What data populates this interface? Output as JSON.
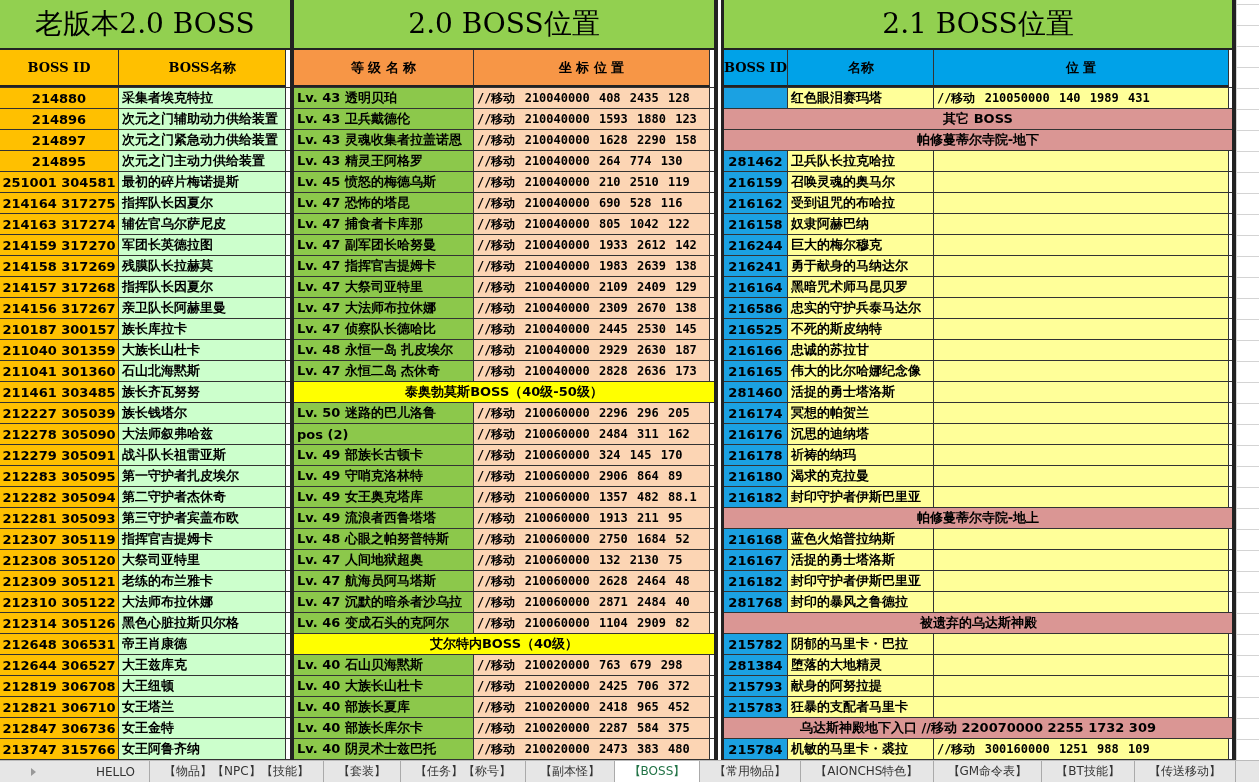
{
  "titles": [
    "老版本2.0 BOSS",
    "2.0 BOSS位置",
    "2.1 BOSS位置"
  ],
  "headers": {
    "old": [
      "BOSS ID",
      "BOSS名称"
    ],
    "v20": [
      "等 级 名 称",
      "坐 标 位 置"
    ],
    "v21": [
      "BOSS ID",
      "名称",
      "位  置"
    ]
  },
  "old_rows": [
    {
      "id": "214880",
      "name": "采集者埃克特拉"
    },
    {
      "id": "214896",
      "name": "次元之门辅助动力供给装置"
    },
    {
      "id": "214897",
      "name": "次元之门紧急动力供给装置"
    },
    {
      "id": "214895",
      "name": "次元之门主动力供给装置"
    },
    {
      "id": "251001 304581",
      "name": "最初的碎片梅诺提斯"
    },
    {
      "id": "214164 317275",
      "name": "指挥队长因夏尔"
    },
    {
      "id": "214163 317274",
      "name": "辅佐官乌尔萨尼皮"
    },
    {
      "id": "214159 317270",
      "name": "军团长英德拉图"
    },
    {
      "id": "214158 317269",
      "name": "残膜队长拉赫莫"
    },
    {
      "id": "214157 317268",
      "name": "指挥队长因夏尔"
    },
    {
      "id": "214156 317267",
      "name": "亲卫队长阿赫里曼"
    },
    {
      "id": "210187 300157",
      "name": "族长库拉卡"
    },
    {
      "id": "211040 301359",
      "name": "大族长山杜卡"
    },
    {
      "id": "211041 301360",
      "name": "石山北海黙斯"
    },
    {
      "id": "211461 303485",
      "name": "族长齐瓦努努"
    },
    {
      "id": "212227 305039",
      "name": "族长钱塔尔"
    },
    {
      "id": "212278 305090",
      "name": "大法师叙弗哈兹"
    },
    {
      "id": "212279 305091",
      "name": "战斗队长祖雷亚斯"
    },
    {
      "id": "212283 305095",
      "name": "第一守护者扎皮埃尔"
    },
    {
      "id": "212282 305094",
      "name": "第二守护者杰休奇"
    },
    {
      "id": "212281 305093",
      "name": "第三守护者宾盖布欧"
    },
    {
      "id": "212307 305119",
      "name": "指挥官吉提姆卡"
    },
    {
      "id": "212308 305120",
      "name": "大祭司亚特里"
    },
    {
      "id": "212309 305121",
      "name": "老练的布兰雅卡"
    },
    {
      "id": "212310 305122",
      "name": "大法师布拉休娜"
    },
    {
      "id": "212314 305126",
      "name": "黑色心脏拉斯贝尔格"
    },
    {
      "id": "212648 306531",
      "name": "帝王肖康德"
    },
    {
      "id": "212644 306527",
      "name": "大王兹库克"
    },
    {
      "id": "212819 306708",
      "name": "大王纽顿"
    },
    {
      "id": "212821 306710",
      "name": "女王塔兰"
    },
    {
      "id": "212847 306736",
      "name": "女王金特"
    },
    {
      "id": "213747 315766",
      "name": "女王阿鲁齐纳"
    }
  ],
  "v20_rows": [
    {
      "kind": "boss",
      "level": "Lv. 43 透明贝珀",
      "coords": "//移动 210040000 408 2435 128"
    },
    {
      "kind": "boss",
      "level": "Lv. 43 卫兵戴德伦",
      "coords": "//移动 210040000 1593 1880 123"
    },
    {
      "kind": "boss",
      "level": "Lv. 43 灵魂收集者拉盖诺恩",
      "coords": "//移动 210040000 1628 2290 158"
    },
    {
      "kind": "boss",
      "level": "Lv. 43 精灵王阿格罗",
      "coords": "//移动 210040000 264 774 130"
    },
    {
      "kind": "boss",
      "level": "Lv. 45 愤怒的梅德乌斯",
      "coords": "//移动 210040000 210 2510 119"
    },
    {
      "kind": "boss",
      "level": "Lv. 47 恐怖的塔昆",
      "coords": "//移动 210040000 690 528 116"
    },
    {
      "kind": "boss",
      "level": "Lv. 47 捕食者卡库那",
      "coords": "//移动 210040000 805 1042 122"
    },
    {
      "kind": "boss",
      "level": "Lv. 47 副军团长哈努曼",
      "coords": "//移动 210040000 1933 2612 142"
    },
    {
      "kind": "boss",
      "level": "Lv. 47 指挥官吉提姆卡",
      "coords": "//移动 210040000 1983 2639 138"
    },
    {
      "kind": "boss",
      "level": "Lv. 47 大祭司亚特里",
      "coords": "//移动 210040000 2109 2409 129"
    },
    {
      "kind": "boss",
      "level": "Lv. 47 大法师布拉休娜",
      "coords": "//移动 210040000 2309 2670 138"
    },
    {
      "kind": "boss",
      "level": "Lv. 47 侦察队长德哈比",
      "coords": "//移动 210040000 2445 2530 145"
    },
    {
      "kind": "boss",
      "level": "Lv. 48 永恒一岛 扎皮埃尔",
      "coords": "//移动 210040000 2929 2630 187"
    },
    {
      "kind": "boss",
      "level": "Lv. 47 永恒二岛 杰休奇",
      "coords": "//移动 210040000 2828 2636 173"
    },
    {
      "kind": "section",
      "title": "泰奥勃莫斯BOSS（40级-50级）"
    },
    {
      "kind": "boss",
      "level": "Lv. 50 迷路的巴儿洛鲁",
      "coords": "//移动 210060000 2296 296 205"
    },
    {
      "kind": "boss",
      "level": "pos (2)",
      "coords": "//移动 210060000 2484 311 162"
    },
    {
      "kind": "boss",
      "level": "Lv. 49 部族长古顿卡",
      "coords": "//移动 210060000 324 145 170"
    },
    {
      "kind": "boss",
      "level": "Lv. 49 守哨克洛林特",
      "coords": "//移动 210060000 2906 864 89"
    },
    {
      "kind": "boss",
      "level": "Lv. 49 女王奥克塔库",
      "coords": "//移动 210060000 1357 482 88.1"
    },
    {
      "kind": "boss",
      "level": "Lv. 49 流浪者西鲁塔塔",
      "coords": "//移动 210060000 1913 211 95"
    },
    {
      "kind": "boss",
      "level": "Lv. 48 心眼之帕努普特斯",
      "coords": "//移动 210060000 2750 1684 52"
    },
    {
      "kind": "boss",
      "level": "Lv. 47 人间地狱超奥",
      "coords": "//移动 210060000 132 2130 75"
    },
    {
      "kind": "boss",
      "level": "Lv. 47 航海员阿马塔斯",
      "coords": "//移动 210060000 2628 2464 48"
    },
    {
      "kind": "boss",
      "level": "Lv. 47 沉默的暗杀者沙乌拉",
      "coords": "//移动 210060000 2871 2484 40"
    },
    {
      "kind": "boss",
      "level": "Lv. 46 变成石头的克阿尔",
      "coords": "//移动 210060000 1104 2909 82"
    },
    {
      "kind": "section",
      "title": "艾尔特内BOSS（40级）"
    },
    {
      "kind": "boss",
      "level": "Lv. 40 石山贝海黙斯",
      "coords": "//移动 210020000 763 679 298"
    },
    {
      "kind": "boss",
      "level": "Lv. 40 大族长山杜卡",
      "coords": "//移动 210020000 2425 706 372"
    },
    {
      "kind": "boss",
      "level": "Lv. 40 部族长夏库",
      "coords": "//移动 210020000 2418 965 452"
    },
    {
      "kind": "boss",
      "level": "Lv. 40 部族长库尔卡",
      "coords": "//移动 210020000 2287 584 375"
    },
    {
      "kind": "boss",
      "level": "Lv. 40 阴灵术士兹巴托",
      "coords": "//移动 210020000 2473 383 480"
    }
  ],
  "v21_rows": [
    {
      "kind": "boss",
      "name": "红色眼泪赛玛塔",
      "position": "//移动 210050000 140 1989 431"
    },
    {
      "kind": "section",
      "title": "其它 BOSS"
    },
    {
      "kind": "section",
      "title": "帕修蔓蒂尔寺院-地下"
    },
    {
      "kind": "boss",
      "id": "281462",
      "name": "卫兵队长拉克哈拉"
    },
    {
      "kind": "boss",
      "id": "216159",
      "name": "召唤灵魂的奥马尔"
    },
    {
      "kind": "boss",
      "id": "216162",
      "name": "受到诅咒的布哈拉"
    },
    {
      "kind": "boss",
      "id": "216158",
      "name": "奴隶阿赫巴纳"
    },
    {
      "kind": "boss",
      "id": "216244",
      "name": "巨大的梅尔穆克"
    },
    {
      "kind": "boss",
      "id": "216241",
      "name": "勇于献身的马纳达尔"
    },
    {
      "kind": "boss",
      "id": "216164",
      "name": "黑暗咒术师马昆贝罗"
    },
    {
      "kind": "boss",
      "id": "216586",
      "name": "忠实的守护兵泰马达尔"
    },
    {
      "kind": "boss",
      "id": "216525",
      "name": "不死的斯皮纳特"
    },
    {
      "kind": "boss",
      "id": "216166",
      "name": "忠诚的苏拉甘"
    },
    {
      "kind": "boss",
      "id": "216165",
      "name": "伟大的比尔哈娜纪念像"
    },
    {
      "kind": "boss",
      "id": "281460",
      "name": "活捉的勇士塔洛斯"
    },
    {
      "kind": "boss",
      "id": "216174",
      "name": "冥想的帕贺兰"
    },
    {
      "kind": "boss",
      "id": "216176",
      "name": "沉思的迪纳塔"
    },
    {
      "kind": "boss",
      "id": "216178",
      "name": "祈祷的纳玛"
    },
    {
      "kind": "boss",
      "id": "216180",
      "name": "渴求的克拉曼"
    },
    {
      "kind": "boss",
      "id": "216182",
      "name": "封印守护者伊斯巴里亚"
    },
    {
      "kind": "section",
      "title": "帕修蔓蒂尔寺院-地上"
    },
    {
      "kind": "boss",
      "id": "216168",
      "name": "蓝色火焰普拉纳斯"
    },
    {
      "kind": "boss",
      "id": "216167",
      "name": "活捉的勇士塔洛斯"
    },
    {
      "kind": "boss",
      "id": "216182",
      "name": "封印守护者伊斯巴里亚"
    },
    {
      "kind": "boss",
      "id": "281768",
      "name": "封印的暴风之鲁德拉"
    },
    {
      "kind": "section",
      "title": "被遗弃的乌达斯神殿"
    },
    {
      "kind": "boss",
      "id": "215782",
      "name": "阴郁的马里卡・巴拉"
    },
    {
      "kind": "boss",
      "id": "281384",
      "name": "堕落的大地精灵"
    },
    {
      "kind": "boss",
      "id": "215793",
      "name": "献身的阿努拉提"
    },
    {
      "kind": "boss",
      "id": "215783",
      "name": "狂暴的支配者马里卡"
    },
    {
      "kind": "section",
      "title": "乌达斯神殿地下入口 //移动 220070000 2255 1732 309"
    },
    {
      "kind": "boss",
      "id": "215784",
      "name": "机敏的马里卡・裘拉",
      "position": "//移动 300160000 1251 988 109"
    }
  ],
  "sheet_tabs": [
    {
      "label": "HELLO",
      "selected": false
    },
    {
      "label": "【物品】【NPC】【技能】",
      "selected": false
    },
    {
      "label": "【套装】",
      "selected": false
    },
    {
      "label": "【任务】【称号】",
      "selected": false
    },
    {
      "label": "【副本怪】",
      "selected": false
    },
    {
      "label": "【BOSS】",
      "selected": true
    },
    {
      "label": "【常用物品】",
      "selected": false
    },
    {
      "label": "【AIONCHS特色】",
      "selected": false
    },
    {
      "label": "【GM命令表】",
      "selected": false
    },
    {
      "label": "【BT技能】",
      "selected": false
    },
    {
      "label": "【传送移动】",
      "selected": false
    }
  ]
}
